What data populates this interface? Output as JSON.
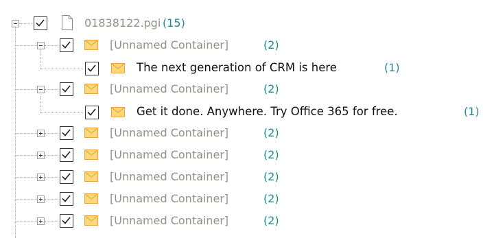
{
  "tree": {
    "root": {
      "label": "01838122.pgi",
      "count": "(15)",
      "icon": "file-icon"
    },
    "items": [
      {
        "label": "[Unnamed Container]",
        "count": "(2)",
        "icon": "envelope-icon"
      },
      {
        "label": "The next generation of CRM is here",
        "count": "(1)",
        "icon": "envelope-icon"
      },
      {
        "label": "[Unnamed Container]",
        "count": "(2)",
        "icon": "envelope-icon"
      },
      {
        "label": "Get it done. Anywhere. Try Office 365 for free.",
        "count": "(1)",
        "icon": "envelope-icon"
      },
      {
        "label": "[Unnamed Container]",
        "count": "(2)",
        "icon": "envelope-icon"
      },
      {
        "label": "[Unnamed Container]",
        "count": "(2)",
        "icon": "envelope-icon"
      },
      {
        "label": "[Unnamed Container]",
        "count": "(2)",
        "icon": "envelope-icon"
      },
      {
        "label": "[Unnamed Container]",
        "count": "(2)",
        "icon": "envelope-icon"
      },
      {
        "label": "[Unnamed Container]",
        "count": "(2)",
        "icon": "envelope-icon"
      }
    ]
  },
  "colors": {
    "count": "#1f8a96",
    "muted_label": "#9a8f86",
    "envelope": "#f2b84b"
  }
}
